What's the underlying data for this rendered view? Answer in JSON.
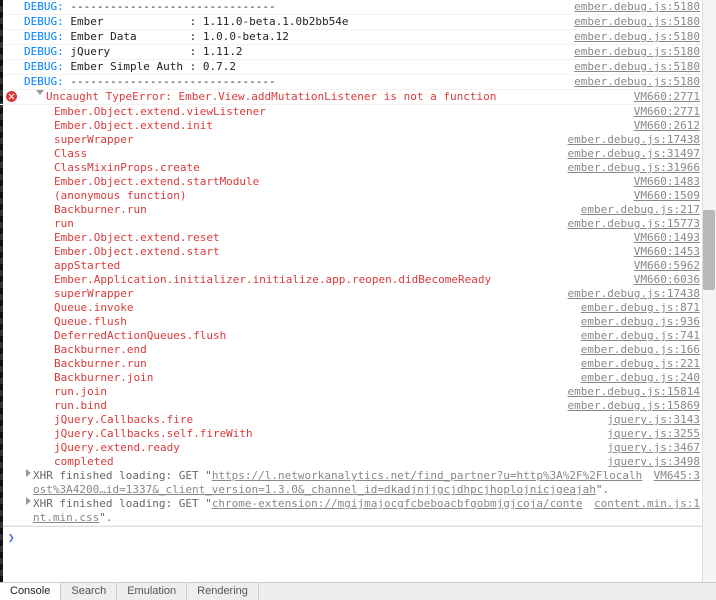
{
  "debug_lines": [
    {
      "prefix": "DEBUG:",
      "msg": " -------------------------------",
      "src": "ember.debug.js:5180"
    },
    {
      "prefix": "DEBUG:",
      "msg": " Ember             : 1.11.0-beta.1.0b2bb54e",
      "src": "ember.debug.js:5180"
    },
    {
      "prefix": "DEBUG:",
      "msg": " Ember Data        : 1.0.0-beta.12",
      "src": "ember.debug.js:5180"
    },
    {
      "prefix": "DEBUG:",
      "msg": " jQuery            : 1.11.2",
      "src": "ember.debug.js:5180"
    },
    {
      "prefix": "DEBUG:",
      "msg": " Ember Simple Auth : 0.7.2",
      "src": "ember.debug.js:5180"
    },
    {
      "prefix": "DEBUG:",
      "msg": " -------------------------------",
      "src": "ember.debug.js:5180"
    }
  ],
  "error": {
    "text": "Uncaught TypeError: Ember.View.addMutationListener is not a function",
    "src": "VM660:2771"
  },
  "trace": [
    {
      "label": "Ember.Object.extend.viewListener",
      "src": "VM660:2771"
    },
    {
      "label": "Ember.Object.extend.init",
      "src": "VM660:2612"
    },
    {
      "label": "superWrapper",
      "src": "ember.debug.js:17438"
    },
    {
      "label": "Class",
      "src": "ember.debug.js:31497"
    },
    {
      "label": "ClassMixinProps.create",
      "src": "ember.debug.js:31966"
    },
    {
      "label": "Ember.Object.extend.startModule",
      "src": "VM660:1483"
    },
    {
      "label": "(anonymous function)",
      "src": "VM660:1509"
    },
    {
      "label": "Backburner.run",
      "src": "ember.debug.js:217"
    },
    {
      "label": "run",
      "src": "ember.debug.js:15773"
    },
    {
      "label": "Ember.Object.extend.reset",
      "src": "VM660:1493"
    },
    {
      "label": "Ember.Object.extend.start",
      "src": "VM660:1453"
    },
    {
      "label": "appStarted",
      "src": "VM660:5962"
    },
    {
      "label": "Ember.Application.initializer.initialize.app.reopen.didBecomeReady",
      "src": "VM660:6036"
    },
    {
      "label": "superWrapper",
      "src": "ember.debug.js:17438"
    },
    {
      "label": "Queue.invoke",
      "src": "ember.debug.js:871"
    },
    {
      "label": "Queue.flush",
      "src": "ember.debug.js:936"
    },
    {
      "label": "DeferredActionQueues.flush",
      "src": "ember.debug.js:741"
    },
    {
      "label": "Backburner.end",
      "src": "ember.debug.js:166"
    },
    {
      "label": "Backburner.run",
      "src": "ember.debug.js:221"
    },
    {
      "label": "Backburner.join",
      "src": "ember.debug.js:240"
    },
    {
      "label": "run.join",
      "src": "ember.debug.js:15814"
    },
    {
      "label": "run.bind",
      "src": "ember.debug.js:15869"
    },
    {
      "label": "jQuery.Callbacks.fire",
      "src": "jquery.js:3143"
    },
    {
      "label": "jQuery.Callbacks.self.fireWith",
      "src": "jquery.js:3255"
    },
    {
      "label": "jQuery.extend.ready",
      "src": "jquery.js:3467"
    },
    {
      "label": "completed",
      "src": "jquery.js:3498"
    }
  ],
  "xhr1": {
    "prefix": "XHR finished loading: GET \"",
    "url_lines": [
      "https://l.networkanalytics.net/find_partner?u=http%3A%2F%2Flocalhost%3A4200…id=1337&_client_version=1.3.0&_channel_id=dkadjnjjgcjdhpcjhoplojnicjgeajah"
    ],
    "suffix": "\".",
    "src": "VM645:3"
  },
  "xhr2": {
    "prefix": "XHR finished loading: GET \"",
    "url_lines": [
      "chrome-extension://mgijmajocgfcbeboacbfgobmjgjcoja/content.min.css"
    ],
    "suffix": "\".",
    "src": "content.min.js:1"
  },
  "prompt_placeholder": "",
  "tabs": [
    "Console",
    "Search",
    "Emulation",
    "Rendering"
  ]
}
